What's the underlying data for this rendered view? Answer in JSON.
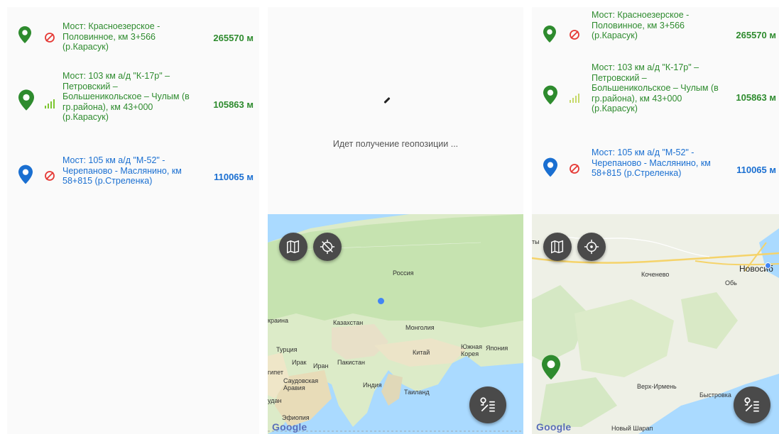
{
  "bridges": [
    {
      "title": "Мост: Красноезерское - Половинное, км 3+566 (р.Карасук)",
      "distance": "265570 м"
    },
    {
      "title": "Мост: 103 км а/д \"К-17р\" – Петровский – Большеникольское – Чулым (в гр.района), км 43+000 (р.Карасук)",
      "distance": "105863 м"
    },
    {
      "title": "Мост: 105 км а/д \"М-52\" - Черепаново - Маслянино, км 58+815 (р.Стреленка)",
      "distance": "110065 м"
    }
  ],
  "loading_text": "Идет получение геопозиции ...",
  "map_world_labels": {
    "russia": "Россия",
    "ukraine": "краина",
    "kazakhstan": "Казахстан",
    "mongolia": "Монголия",
    "turkey": "Турция",
    "iraq": "Ирак",
    "iran": "Иран",
    "pakistan": "Пакистан",
    "china": "Китай",
    "skorea": "Южная Корея",
    "japan": "Япония",
    "egypt": "гипет",
    "saudi": "Саудовская Аравия",
    "india": "Индия",
    "thailand": "Таиланд",
    "sudan": "удан",
    "ethiopia": "Эфиопия"
  },
  "map_local_labels": {
    "novosibirsk": "Новосиб",
    "ob": "Обь",
    "kochenevo": "Коченево",
    "verkh_irmen": "Верх-Ирмень",
    "bystrovka": "Быстровка",
    "novy_sharap": "Новый Шарап",
    "ty": "ты"
  },
  "google_logo": "Google",
  "colors": {
    "green": "#2e8b2e",
    "blue": "#1a6fd1",
    "red": "#e53935",
    "fab": "#4a4a4a"
  }
}
